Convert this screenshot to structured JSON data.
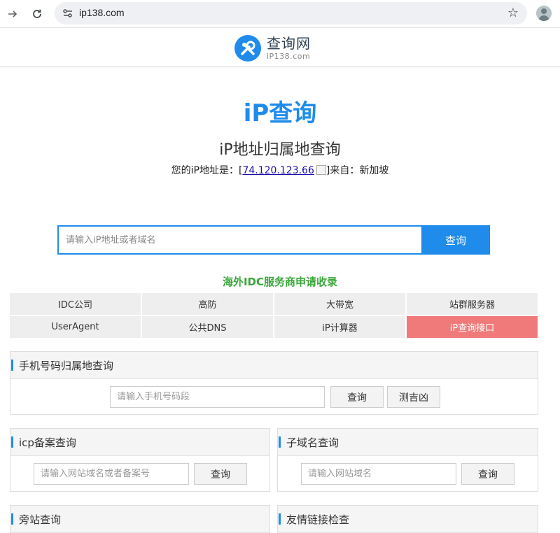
{
  "browser": {
    "url": "ip138.com",
    "back_icon": "arrow-right-icon",
    "reload_icon": "reload-icon",
    "bookmark_icon": "star-icon"
  },
  "site": {
    "logo_cn": "查询网",
    "logo_en": "iP138.com",
    "hero_title": "iP查询",
    "subtitle": "iP地址归属地查询",
    "ip_prefix": "您的iP地址是：[",
    "ip_value": "74.120.123.66",
    "ip_suffix": "]来自：新加坡",
    "accent_color": "#1f8ceb"
  },
  "search": {
    "placeholder": "请输入iP地址或者域名",
    "button": "查询"
  },
  "promo": "海外IDC服务商申请收录",
  "links": [
    {
      "label": "IDC公司"
    },
    {
      "label": "高防"
    },
    {
      "label": "大带宽"
    },
    {
      "label": "站群服务器"
    },
    {
      "label": "UserAgent"
    },
    {
      "label": "公共DNS"
    },
    {
      "label": "iP计算器"
    },
    {
      "label": "iP查询接口"
    }
  ],
  "panels": {
    "phone": {
      "title": "手机号码归属地查询",
      "placeholder": "请输入手机号码段",
      "query": "查询",
      "fortune": "测吉凶"
    },
    "icp": {
      "title": "icp备案查询",
      "placeholder": "请输入网站域名或者备案号",
      "query": "查询"
    },
    "subdomain": {
      "title": "子域名查询",
      "placeholder": "请输入网站域名",
      "query": "查询"
    },
    "sibling": {
      "title": "旁站查询"
    },
    "friendlink": {
      "title": "友情链接检查"
    }
  }
}
